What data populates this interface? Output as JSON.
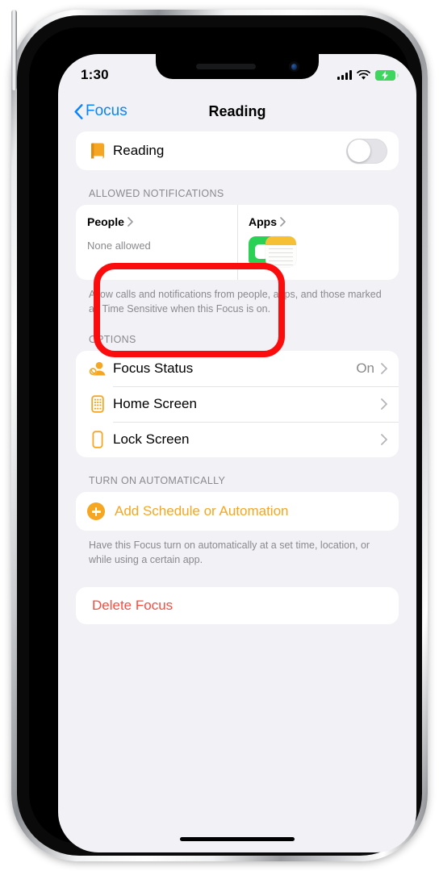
{
  "status_bar": {
    "time": "1:30",
    "cellular_icon": "signal-bars-icon",
    "wifi_icon": "wifi-icon",
    "battery_icon": "battery-charging-icon"
  },
  "nav": {
    "back_label": "Focus",
    "back_icon": "chevron-left-icon",
    "title": "Reading"
  },
  "focus_toggle": {
    "icon": "book-icon",
    "label": "Reading",
    "state": "off"
  },
  "allowed_notifications": {
    "header": "ALLOWED NOTIFICATIONS",
    "people": {
      "title": "People",
      "chevron_icon": "chevron-right-icon",
      "subtitle": "None allowed"
    },
    "apps": {
      "title": "Apps",
      "chevron_icon": "chevron-right-icon",
      "app_icons": [
        "facetime-icon",
        "notes-icon"
      ]
    },
    "footer": "Allow calls and notifications from people, apps, and those marked as Time Sensitive when this Focus is on."
  },
  "options": {
    "header": "OPTIONS",
    "rows": [
      {
        "icon": "focus-status-icon",
        "label": "Focus Status",
        "value": "On",
        "chevron_icon": "chevron-right-icon"
      },
      {
        "icon": "home-screen-icon",
        "label": "Home Screen",
        "value": "",
        "chevron_icon": "chevron-right-icon"
      },
      {
        "icon": "lock-screen-icon",
        "label": "Lock Screen",
        "value": "",
        "chevron_icon": "chevron-right-icon"
      }
    ]
  },
  "turn_on_automatically": {
    "header": "TURN ON AUTOMATICALLY",
    "add_label": "Add Schedule or Automation",
    "add_icon": "plus-circle-icon",
    "footer": "Have this Focus turn on automatically at a set time, location, or while using a certain app."
  },
  "delete": {
    "label": "Delete Focus"
  },
  "annotation": {
    "shape": "rounded-rectangle-highlight",
    "color": "#fb0d0d",
    "targets": "people-cell"
  },
  "colors": {
    "accent_orange": "#f5a623",
    "link_blue": "#0a84ff",
    "destructive_red": "#ff4a3d",
    "screen_bg": "#f2f1f6",
    "card_bg": "#ffffff",
    "secondary_text": "#8a8a8e",
    "annotation_red": "#fb0d0d"
  }
}
